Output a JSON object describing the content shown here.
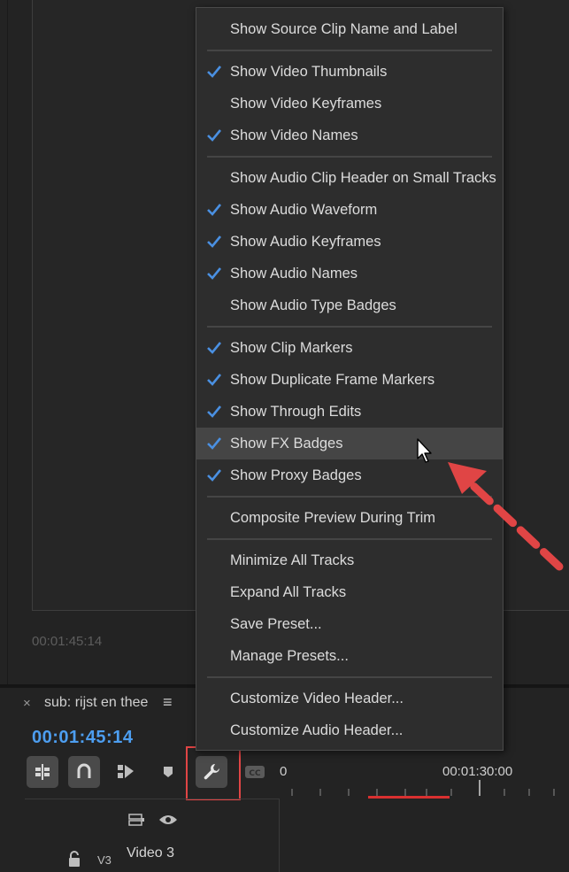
{
  "monitor": {
    "timecode": "00:01:45:14"
  },
  "timeline": {
    "tab_close": "×",
    "sequence_name": "sub: rijst en thee",
    "menu_glyph": "≡",
    "current_timecode": "00:01:45:14",
    "ruler_start": "0",
    "ruler_mark": "00:01:30:00",
    "track": {
      "id": "V3",
      "name": "Video 3"
    }
  },
  "menu": {
    "items": [
      {
        "label": "Show Source Clip Name and Label",
        "checked": false
      },
      {
        "label": "Show Video Thumbnails",
        "checked": true
      },
      {
        "label": "Show Video Keyframes",
        "checked": false
      },
      {
        "label": "Show Video Names",
        "checked": true
      },
      {
        "label": "Show Audio Clip Header on Small Tracks",
        "checked": false
      },
      {
        "label": "Show Audio Waveform",
        "checked": true
      },
      {
        "label": "Show Audio Keyframes",
        "checked": true
      },
      {
        "label": "Show Audio Names",
        "checked": true
      },
      {
        "label": "Show Audio Type Badges",
        "checked": false
      },
      {
        "label": "Show Clip Markers",
        "checked": true
      },
      {
        "label": "Show Duplicate Frame Markers",
        "checked": true
      },
      {
        "label": "Show Through Edits",
        "checked": true
      },
      {
        "label": "Show FX Badges",
        "checked": true,
        "hovered": true
      },
      {
        "label": "Show Proxy Badges",
        "checked": true
      },
      {
        "label": "Composite Preview During Trim",
        "checked": false
      },
      {
        "label": "Minimize All Tracks",
        "checked": false
      },
      {
        "label": "Expand All Tracks",
        "checked": false
      },
      {
        "label": "Save Preset...",
        "checked": false
      },
      {
        "label": "Manage Presets...",
        "checked": false
      },
      {
        "label": "Customize Video Header...",
        "checked": false
      },
      {
        "label": "Customize Audio Header...",
        "checked": false
      }
    ]
  },
  "colors": {
    "accent": "#4d9ef0",
    "annotation": "#e04545",
    "checkmark": "#4a90e2"
  }
}
